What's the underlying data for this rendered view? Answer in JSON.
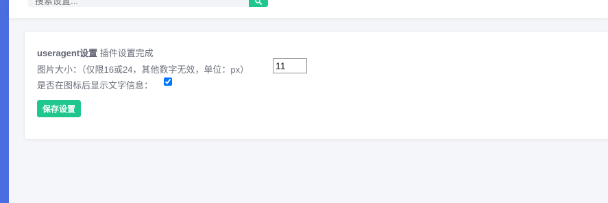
{
  "search": {
    "placeholder": "搜索设置...",
    "icon": "search-icon"
  },
  "settings": {
    "plugin_name": "useragent设置",
    "status_message": "插件设置完成",
    "image_size_label": "图片大小：（仅限16或24，其他数字无效，单位：px）",
    "image_size_value": "11",
    "show_text_label": "是否在图标后显示文字信息：",
    "show_text_checked": true,
    "save_button_label": "保存设置"
  },
  "colors": {
    "accent": "#1fc78d",
    "sidebar": "#4a6de0",
    "text": "#6b6f7b"
  }
}
